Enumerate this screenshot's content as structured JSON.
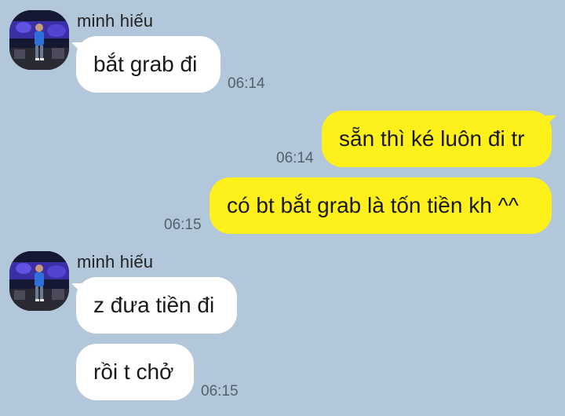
{
  "colors": {
    "background": "#b2c7d9",
    "incoming_bubble": "#ffffff",
    "outgoing_bubble": "#fef01b",
    "timestamp": "#56606b"
  },
  "messages": [
    {
      "direction": "incoming",
      "sender": "minh hiếu",
      "avatar_icon": "user-avatar",
      "text": "bắt grab đi",
      "time": "06:14"
    },
    {
      "direction": "outgoing",
      "text": "sẵn thì ké luôn đi tr",
      "time": "06:14"
    },
    {
      "direction": "outgoing",
      "text": "có bt bắt grab là tốn tiền kh ^^",
      "time": "06:15"
    },
    {
      "direction": "incoming",
      "sender": "minh hiếu",
      "avatar_icon": "user-avatar",
      "text": "z đưa tiền đi",
      "time": ""
    },
    {
      "direction": "incoming",
      "text": "rồi t chở",
      "time": "06:15"
    }
  ]
}
